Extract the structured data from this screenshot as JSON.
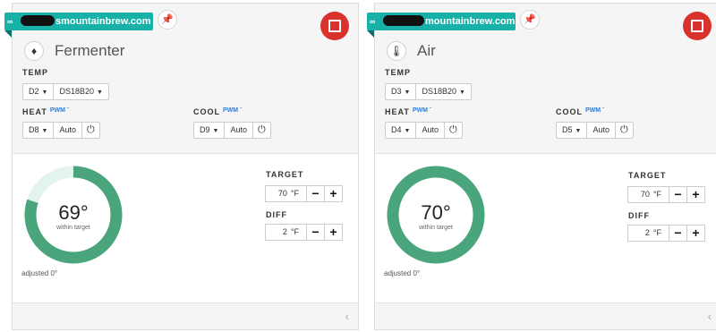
{
  "colors": {
    "accent": "#17b1a8",
    "stop": "#d9312b",
    "ring": "#4aa57d",
    "ring_track": "#e3f4ec",
    "pwm": "#2a7de1"
  },
  "icons": {
    "link": "link-icon",
    "pin": "pin-icon",
    "stop": "stop-icon",
    "power": "power-icon",
    "chevron": "chevron-left-icon"
  },
  "controllers": [
    {
      "device_label": "smountainbrew.com",
      "name": "Fermenter",
      "sensor_icon": "thermometer-probe-icon",
      "temp_label": "TEMP",
      "temp_pin": "D2",
      "temp_sensor": "DS18B20",
      "heat_label": "HEAT",
      "heat_pwm": "PWM",
      "heat_pin": "D8",
      "heat_mode": "Auto",
      "cool_label": "COOL",
      "cool_pwm": "PWM",
      "cool_pin": "D9",
      "cool_mode": "Auto",
      "current_temp": "69°",
      "status": "within target",
      "ring_fill": 0.8,
      "adjusted": "adjusted 0°",
      "target_label": "TARGET",
      "target_value": "70",
      "target_unit": "°F",
      "diff_label": "DIFF",
      "diff_value": "2",
      "diff_unit": "°F",
      "minus": "−",
      "plus": "+"
    },
    {
      "device_label": "mountainbrew.com",
      "name": "Air",
      "sensor_icon": "thermometer-icon",
      "temp_label": "TEMP",
      "temp_pin": "D3",
      "temp_sensor": "DS18B20",
      "heat_label": "HEAT",
      "heat_pwm": "PWM",
      "heat_pin": "D4",
      "heat_mode": "Auto",
      "cool_label": "COOL",
      "cool_pwm": "PWM",
      "cool_pin": "D5",
      "cool_mode": "Auto",
      "current_temp": "70°",
      "status": "within target",
      "ring_fill": 1.0,
      "adjusted": "adjusted 0°",
      "target_label": "TARGET",
      "target_value": "70",
      "target_unit": "°F",
      "diff_label": "DIFF",
      "diff_value": "2",
      "diff_unit": "°F",
      "minus": "−",
      "plus": "+"
    }
  ]
}
